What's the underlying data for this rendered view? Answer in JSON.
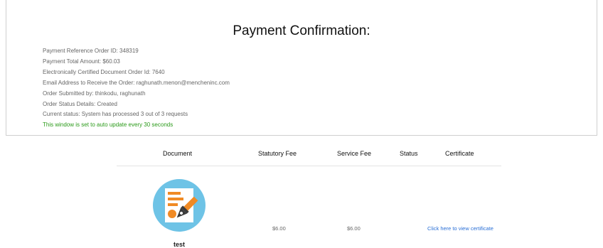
{
  "confirmation": {
    "title": "Payment Confirmation:",
    "details": [
      "Payment Reference Order ID: 348319",
      "Payment Total Amount: $60.03",
      "Electronically Certified Document Order Id: 7640",
      "Email Address to Receive the Order: raghunath.menon@mencheninc.com",
      "Order Submitted by: thinkodu, raghunath",
      "Order Status Details: Created",
      "Current status: System has processed 3 out of 3 requests"
    ],
    "auto_update_note": "This window is set to auto update every 30 seconds",
    "auto_update_color": "#2a9a19"
  },
  "table": {
    "headers": {
      "document": "Document",
      "statutory_fee": "Statutory Fee",
      "service_fee": "Service Fee",
      "status": "Status",
      "certificate": "Certificate"
    },
    "rows": [
      {
        "icon": "document-pen-icon",
        "document_name": "test",
        "statutory_fee": "$6.00",
        "service_fee": "$6.00",
        "status": "",
        "certificate_link": "Click here to view certificate"
      }
    ]
  },
  "colors": {
    "link": "#2a6fd6",
    "icon_circle": "#6ec3e6",
    "icon_accent": "#f08a24"
  }
}
